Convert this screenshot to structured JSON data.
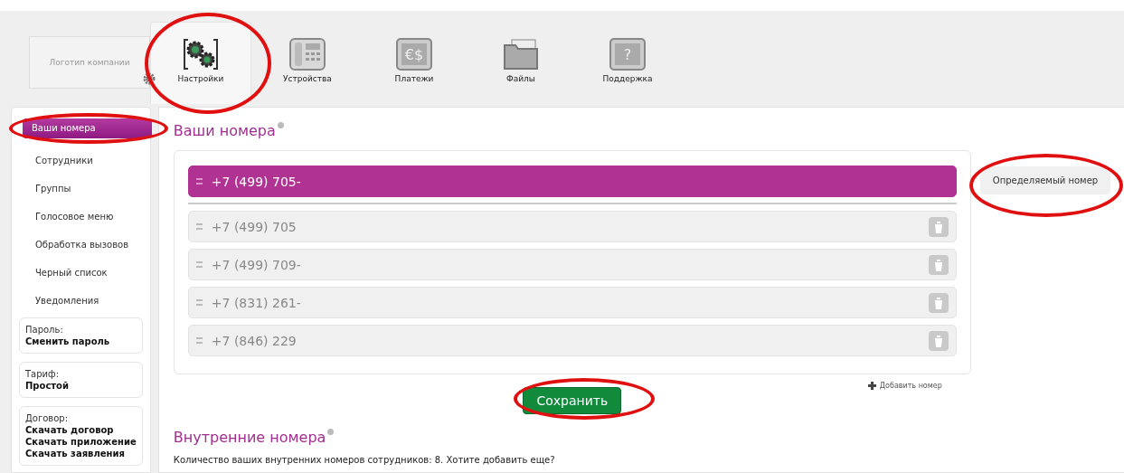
{
  "header": {
    "logo_placeholder": "Логотип компании",
    "nav": [
      {
        "label": "Настройки",
        "selected": true
      },
      {
        "label": "Устройства",
        "selected": false
      },
      {
        "label": "Платежи",
        "icon_glyph": "€$",
        "selected": false
      },
      {
        "label": "Файлы",
        "selected": false
      },
      {
        "label": "Поддержка",
        "icon_glyph": "?",
        "selected": false
      }
    ]
  },
  "sidebar": {
    "items": [
      {
        "label": "Ваши номера",
        "selected": true
      },
      {
        "label": "Сотрудники",
        "selected": false
      },
      {
        "label": "Группы",
        "selected": false
      },
      {
        "label": "Голосовое меню",
        "selected": false
      },
      {
        "label": "Обработка вызовов",
        "selected": false
      },
      {
        "label": "Черный список",
        "selected": false
      },
      {
        "label": "Уведомления",
        "selected": false
      }
    ],
    "boxes": [
      {
        "title": "Пароль:",
        "links": [
          "Сменить пароль"
        ]
      },
      {
        "title": "Тариф:",
        "links": [
          "Простой"
        ]
      },
      {
        "title": "Договор:",
        "links": [
          "Скачать договор",
          "Скачать приложение",
          "Скачать заявления"
        ]
      }
    ]
  },
  "numbers_section": {
    "title": "Ваши номера",
    "numbers": [
      {
        "number": "+7 (499) 705-",
        "selected": true
      },
      {
        "number": "+7 (499) 705",
        "selected": false
      },
      {
        "number": "+7 (499) 709-",
        "selected": false
      },
      {
        "number": "+7 (831) 261-",
        "selected": false
      },
      {
        "number": "+7 (846) 229",
        "selected": false
      }
    ],
    "caller_id_label": "Определяемый номер",
    "add_link": "Добавить номер",
    "save_button": "Сохранить"
  },
  "internal_section": {
    "title": "Внутренние номера",
    "text": "Количество ваших внутренних номеров сотрудников: 8. Хотите добавить еще?"
  }
}
